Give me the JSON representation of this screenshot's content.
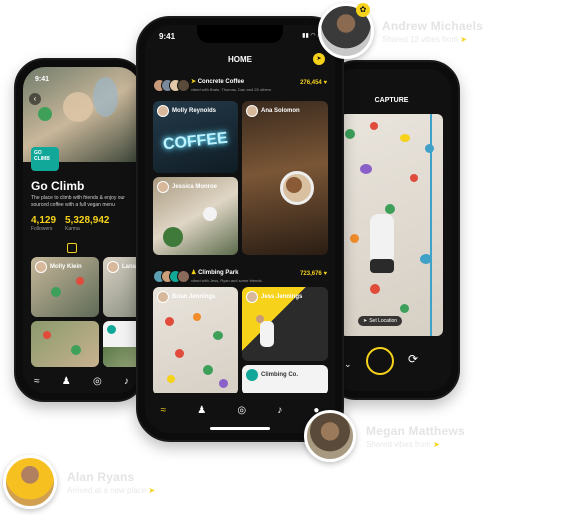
{
  "left_phone": {
    "status_time": "9:41",
    "logo_text": "GO CLIMB",
    "title": "Go Climb",
    "description": "The place to climb with friends & enjoy our sourced coffee with a full vegan menu",
    "stats": [
      {
        "value": "4,129",
        "label": "Followers"
      },
      {
        "value": "5,328,942",
        "label": "Karma"
      }
    ],
    "tiles": [
      {
        "name": "Molly Klein"
      },
      {
        "name": "Lanah"
      }
    ]
  },
  "center_phone": {
    "status_time": "9:41",
    "title": "HOME",
    "group1": {
      "name": "Concrete Coffee",
      "vibed": "vibed with Brain, Thomas, Dan and 25 others",
      "count": "276,454"
    },
    "group1_tiles": [
      {
        "name": "Molly Reynolds"
      },
      {
        "name": "Ana Solomon"
      },
      {
        "name": "Jessica Monroe"
      }
    ],
    "coffee_sign": "COFFEE",
    "group2": {
      "name": "Climbing Park",
      "vibed": "vibed with Jess, Ryan and some friends.",
      "count": "723,676"
    },
    "group2_tiles": [
      {
        "name": "Brian Jennings"
      },
      {
        "name": "Jess Jennings"
      },
      {
        "name": "Climbing Co."
      }
    ]
  },
  "right_phone": {
    "title": "CAPTURE",
    "location_button": "Set Location"
  },
  "floating_users": [
    {
      "name": "Andrew Michaels",
      "sub": "Shared 12 vibes from"
    },
    {
      "name": "Megan Matthews",
      "sub": "Shared vibes from"
    },
    {
      "name": "Alan Ryans",
      "sub": "Arrived at a new place"
    }
  ],
  "colors": {
    "accent": "#f6d21b",
    "dark": "#111111"
  }
}
